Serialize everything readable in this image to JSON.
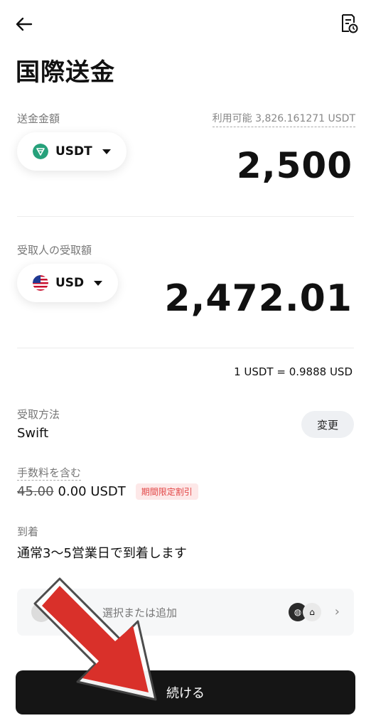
{
  "header": {
    "title": "国際送金"
  },
  "send": {
    "label": "送金金額",
    "available": "利用可能 3,826.161271 USDT",
    "currency": "USDT",
    "amount": "2,500"
  },
  "receive": {
    "label": "受取人の受取額",
    "currency": "USD",
    "amount": "2,472.01"
  },
  "rate": "1 USDT  = 0.9888 USD",
  "method": {
    "label": "受取方法",
    "value": "Swift",
    "change_label": "変更"
  },
  "fee": {
    "label": "手数料を含む",
    "old": "45.00",
    "value": "0.00 USDT",
    "badge": "期間限定割引"
  },
  "arrival": {
    "label": "到着",
    "value": "通常3〜5営業日で到着します"
  },
  "recipient": {
    "placeholder": "選択または追加"
  },
  "continue_label": "続ける",
  "colors": {
    "primary_button": "#151515",
    "tether": "#26a17b",
    "badge_text": "#e24545",
    "badge_bg": "#fde8e8",
    "overlay_arrow": "#d9302a"
  }
}
